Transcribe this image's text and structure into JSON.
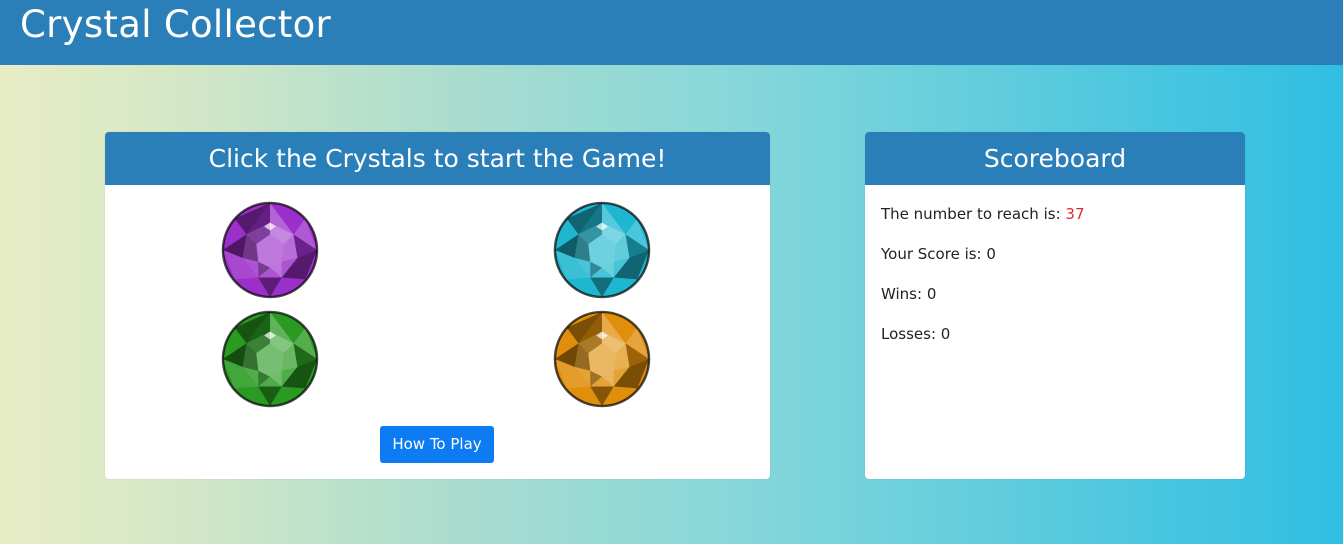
{
  "header": {
    "title": "Crystal Collector"
  },
  "game": {
    "heading": "Click the Crystals to start the Game!",
    "crystals": [
      {
        "name": "purple",
        "color": "#9b2fc9"
      },
      {
        "name": "cyan",
        "color": "#1fb7d0"
      },
      {
        "name": "green",
        "color": "#2a9a22"
      },
      {
        "name": "amber",
        "color": "#e08f0c"
      }
    ],
    "how_to_play_label": "How To Play"
  },
  "scoreboard": {
    "heading": "Scoreboard",
    "target_label": "The number to reach is:",
    "target_value": "37",
    "score_label": "Your Score is:",
    "score_value": "0",
    "wins_label": "Wins:",
    "wins_value": "0",
    "losses_label": "Losses:",
    "losses_value": "0"
  },
  "colors": {
    "header_bg": "#2a7fb8",
    "button_bg": "#0d7bf2",
    "target_number": "#d8302c"
  }
}
